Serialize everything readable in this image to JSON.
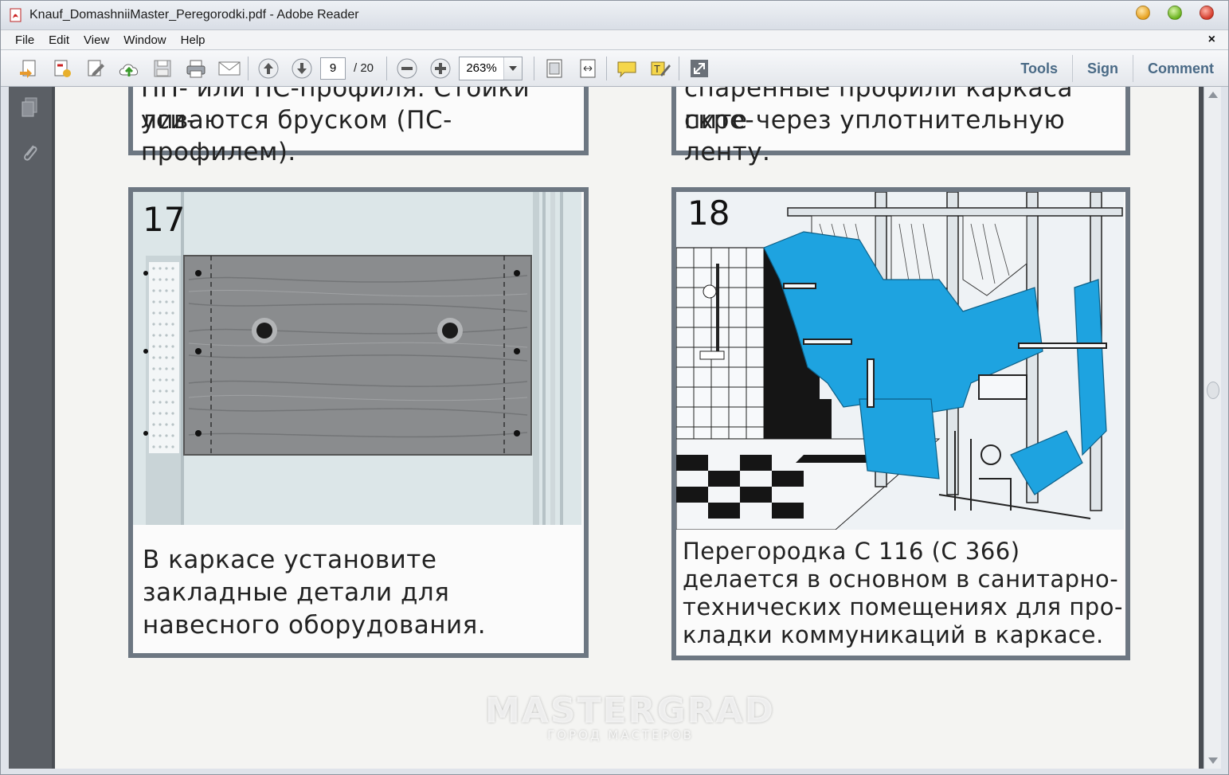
{
  "window": {
    "title": "Knauf_DomashniiMaster_Peregorodki.pdf - Adobe Reader"
  },
  "menu": {
    "items": [
      "File",
      "Edit",
      "View",
      "Window",
      "Help"
    ],
    "close_glyph": "×"
  },
  "toolbar": {
    "current_page": "9",
    "total_pages": "/ 20",
    "zoom": "263%",
    "right_links": [
      "Tools",
      "Sign",
      "Comment"
    ]
  },
  "document": {
    "top_left_text_line1": "ПП- или ПС-профиля. Стойки уси-",
    "top_left_text_line2": "ливаются бруском (ПС-профилем).",
    "top_right_text_line1": "спаренные профили каркаса скре-",
    "top_right_text_line2": "пите через уплотнительную ленту.",
    "panel17": {
      "number": "17",
      "caption_line1": "В  каркасе установите",
      "caption_line2": "закладные детали для",
      "caption_line3": "навесного оборудования."
    },
    "panel18": {
      "number": "18",
      "caption_line1": "Перегородка С 116 (С 366)",
      "caption_line2": "делается в основном в санитарно-",
      "caption_line3": "технических помещениях для про-",
      "caption_line4": "кладки коммуникаций в каркасе."
    },
    "watermark_main": "MASTERGRAD",
    "watermark_sub": "ГОРОД МАСТЕРОВ"
  },
  "colors": {
    "panel_border": "#6d7782",
    "insulation_blue": "#1ea3e0",
    "link_text": "#4a6a86"
  }
}
